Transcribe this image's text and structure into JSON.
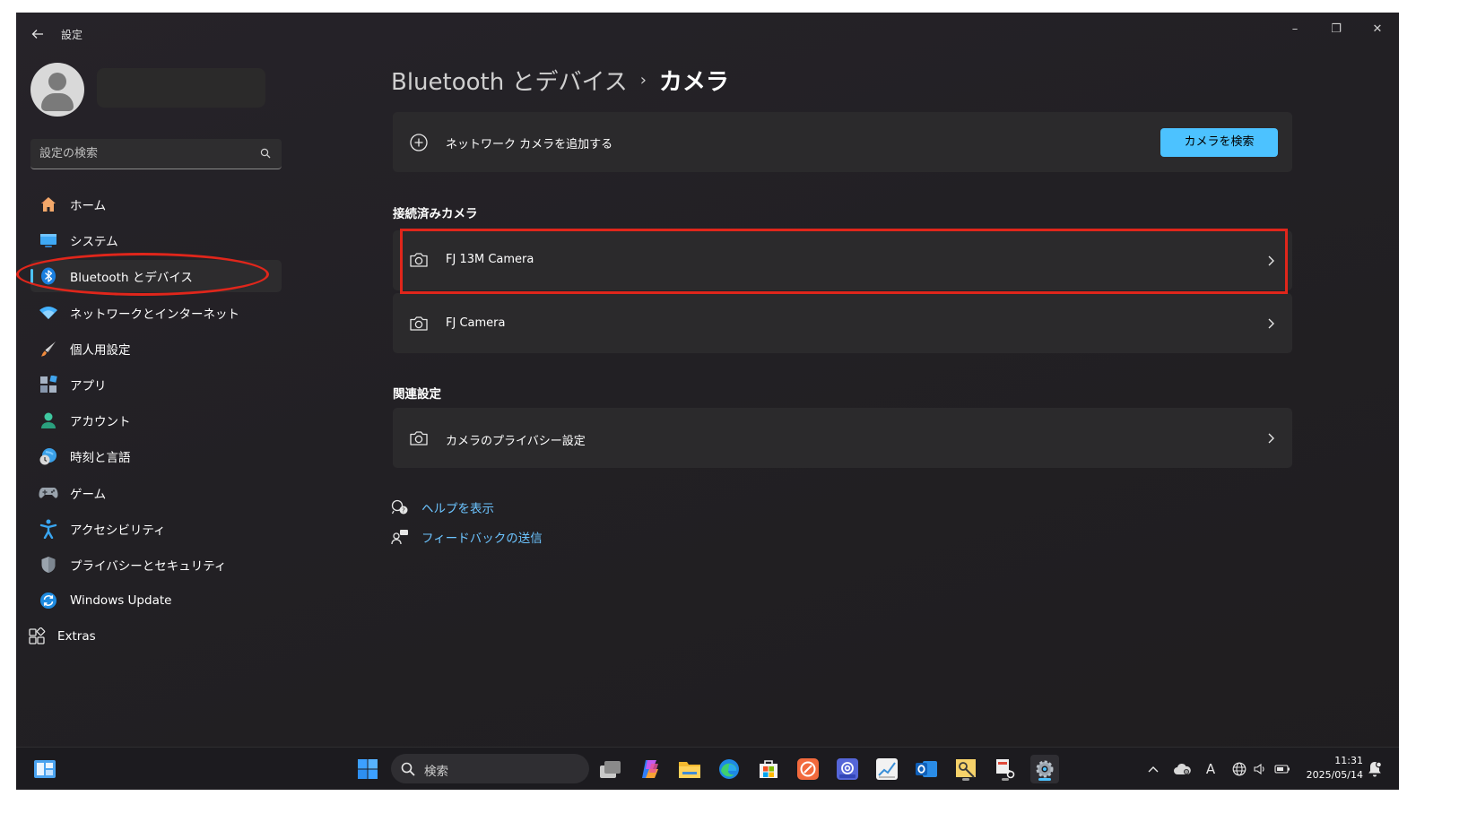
{
  "window": {
    "title": "設定",
    "controls": {
      "minimize": "–",
      "restore": "❐",
      "close": "✕"
    }
  },
  "search": {
    "placeholder": "設定の検索"
  },
  "sidebar": {
    "items": [
      {
        "label": "ホーム",
        "icon": "home-icon",
        "active": false
      },
      {
        "label": "システム",
        "icon": "system-icon",
        "active": false
      },
      {
        "label": "Bluetooth とデバイス",
        "icon": "bluetooth-icon",
        "active": true
      },
      {
        "label": "ネットワークとインターネット",
        "icon": "wifi-icon",
        "active": false
      },
      {
        "label": "個人用設定",
        "icon": "brush-icon",
        "active": false
      },
      {
        "label": "アプリ",
        "icon": "apps-icon",
        "active": false
      },
      {
        "label": "アカウント",
        "icon": "account-icon",
        "active": false
      },
      {
        "label": "時刻と言語",
        "icon": "time-language-icon",
        "active": false
      },
      {
        "label": "ゲーム",
        "icon": "gamepad-icon",
        "active": false
      },
      {
        "label": "アクセシビリティ",
        "icon": "accessibility-icon",
        "active": false
      },
      {
        "label": "プライバシーとセキュリティ",
        "icon": "shield-icon",
        "active": false
      },
      {
        "label": "Windows Update",
        "icon": "update-icon",
        "active": false
      },
      {
        "label": "Extras",
        "icon": "extras-icon",
        "active": false
      }
    ]
  },
  "main": {
    "breadcrumb": {
      "parent": "Bluetooth とデバイス",
      "separator": "›",
      "current": "カメラ"
    },
    "add_camera": {
      "label": "ネットワーク カメラを追加する",
      "button": "カメラを検索"
    },
    "connected_heading": "接続済みカメラ",
    "cameras": [
      {
        "label": "FJ 13M Camera"
      },
      {
        "label": "FJ Camera"
      }
    ],
    "related_heading": "関連設定",
    "privacy": {
      "label": "カメラのプライバシー設定"
    },
    "links": {
      "help": "ヘルプを表示",
      "feedback": "フィードバックの送信"
    }
  },
  "taskbar": {
    "search_label": "検索",
    "clock": {
      "time": "11:31",
      "date": "2025/05/14"
    },
    "ime": "A"
  },
  "colors": {
    "accent": "#4cc2ff",
    "annotation": "#e0261b",
    "card": "#2b2a2c",
    "link": "#6cc4ff"
  }
}
